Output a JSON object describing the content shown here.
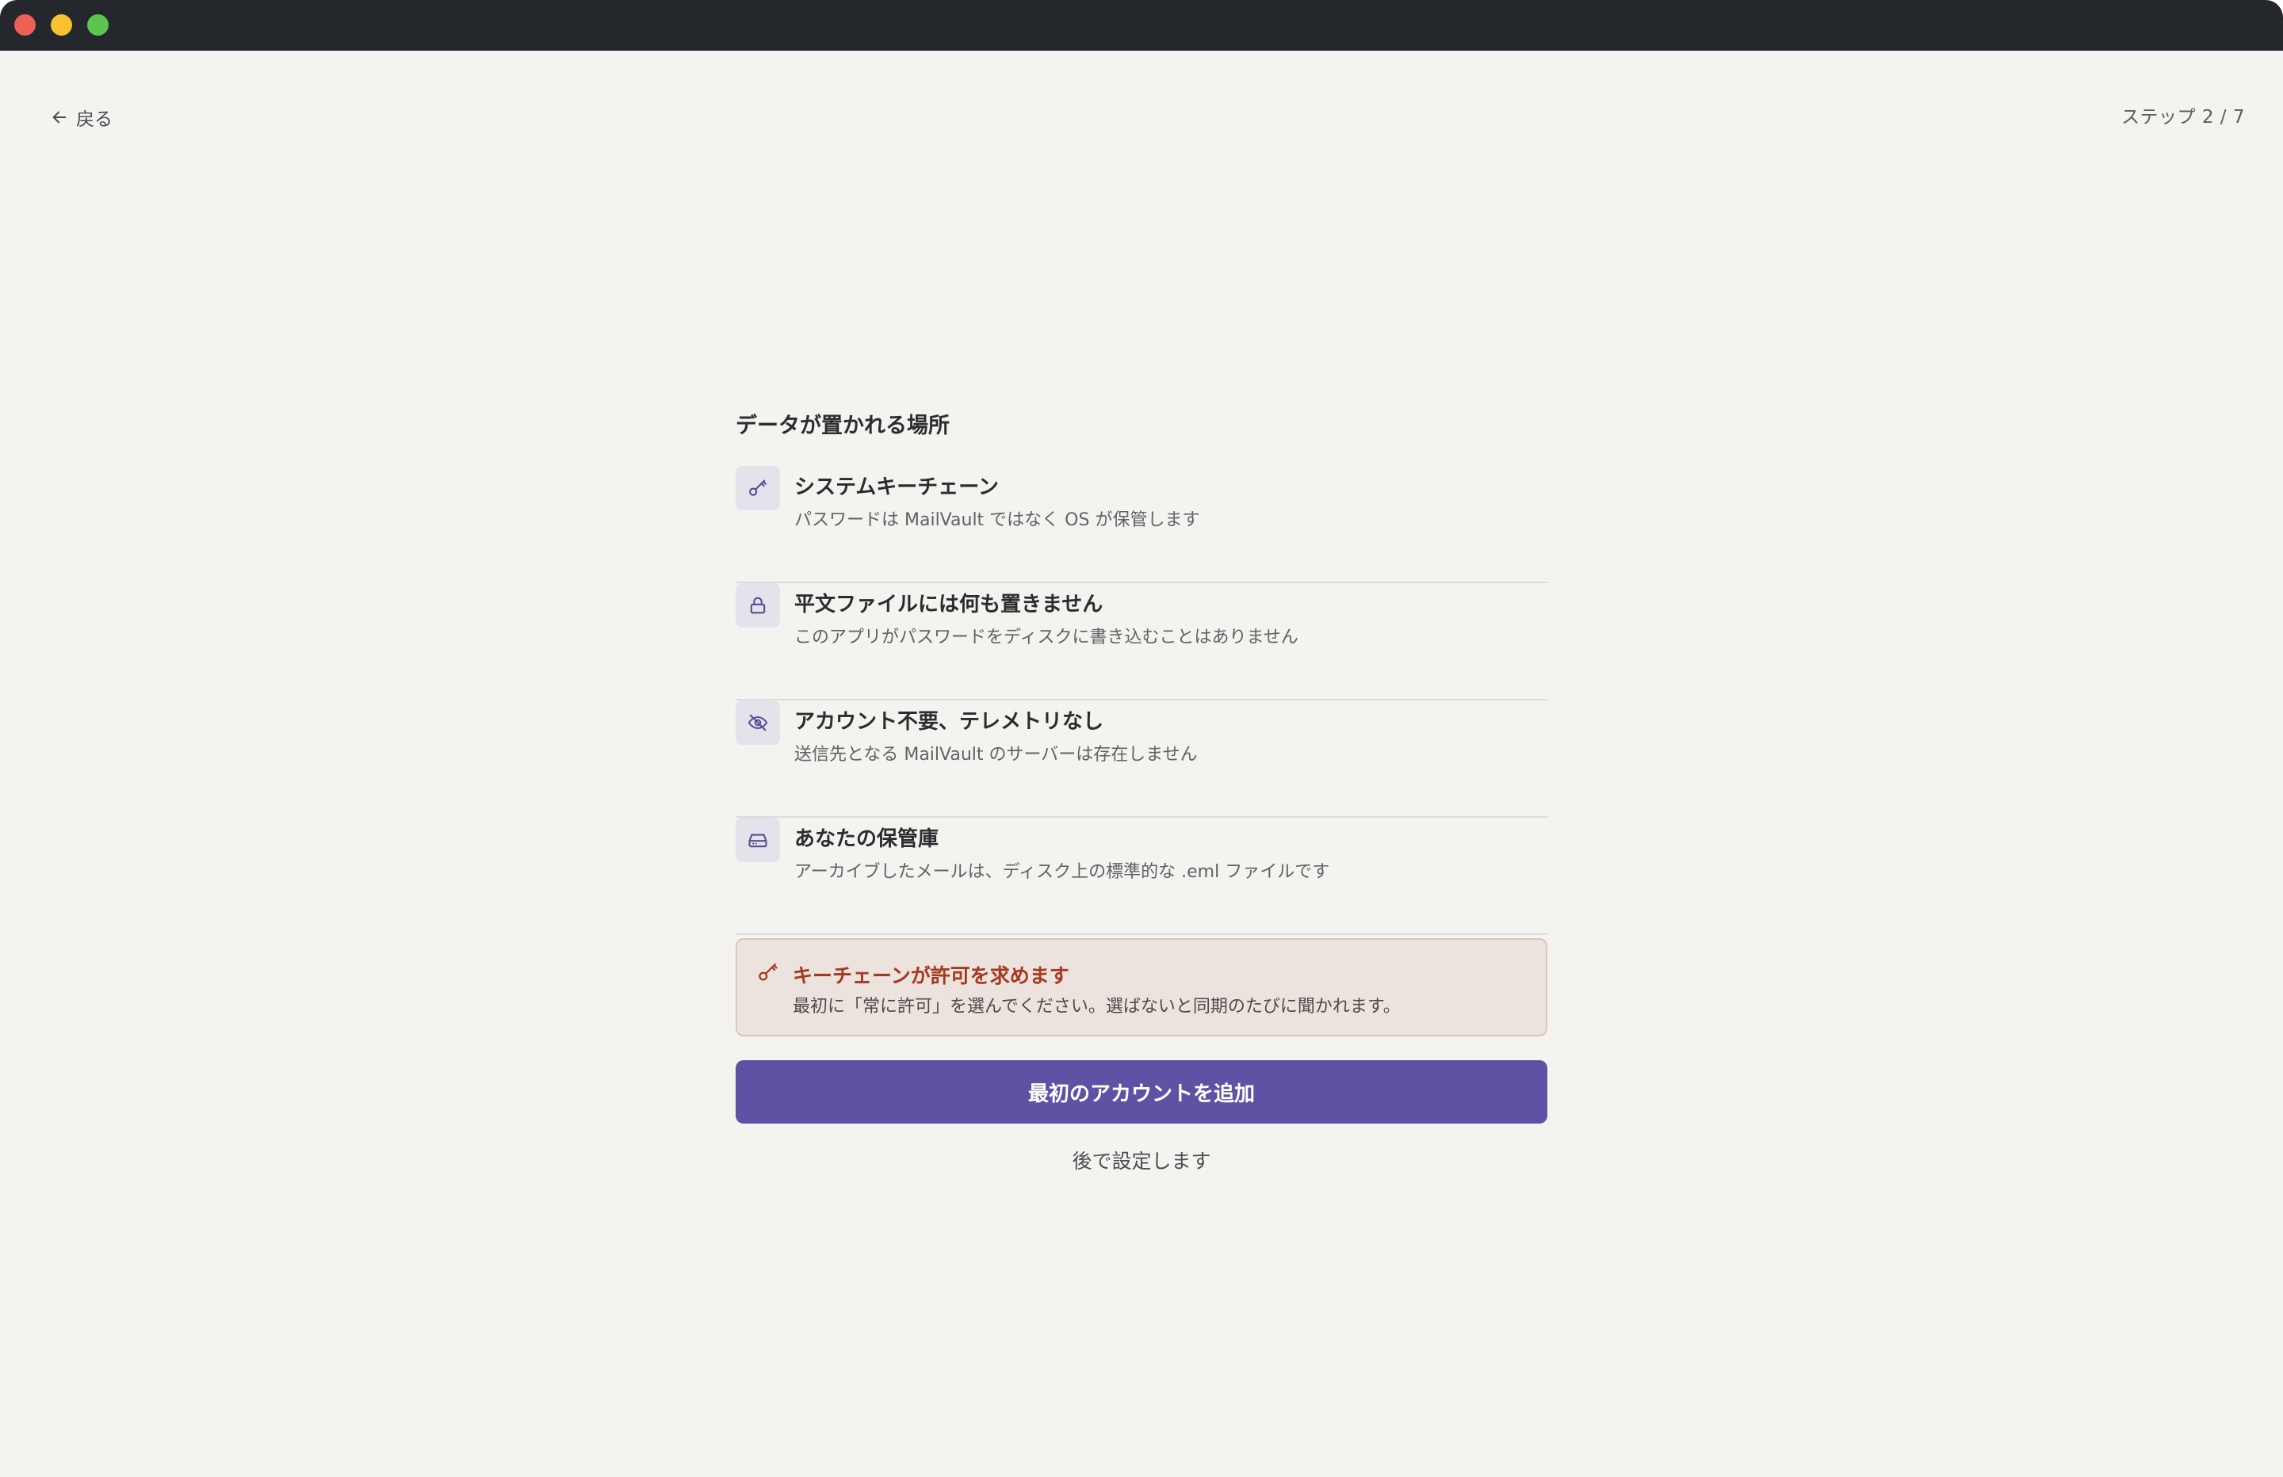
{
  "window": {
    "controls": [
      "close",
      "minimize",
      "maximize"
    ]
  },
  "nav": {
    "back_label": "戻る",
    "back_icon": "arrow-left-icon",
    "step_label": "ステップ 2 / 7"
  },
  "section": {
    "title": "データが置かれる場所"
  },
  "items": [
    {
      "icon": "key-icon",
      "title": "システムキーチェーン",
      "description": "パスワードは MailVault ではなく OS が保管します"
    },
    {
      "icon": "lock-icon",
      "title": "平文ファイルには何も置きません",
      "description": "このアプリがパスワードをディスクに書き込むことはありません"
    },
    {
      "icon": "eye-off-icon",
      "title": "アカウント不要、テレメトリなし",
      "description": "送信先となる MailVault のサーバーは存在しません"
    },
    {
      "icon": "hard-drive-icon",
      "title": "あなたの保管庫",
      "description": "アーカイブしたメールは、ディスク上の標準的な .eml ファイルです"
    }
  ],
  "notice": {
    "icon": "key-icon",
    "title": "キーチェーンが許可を求めます",
    "description": "最初に「常に許可」を選んでください。選ばないと同期のたびに聞かれます。"
  },
  "actions": {
    "primary_label": "最初のアカウントを追加",
    "secondary_label": "後で設定します"
  },
  "colors": {
    "background": "#f4f3f0",
    "titlebar": "#24272b",
    "accent": "#5e52a4",
    "icon_tile": "#e4e2eb",
    "icon_stroke": "#5a4d96",
    "notice_bg": "#ece2de",
    "notice_border": "#ddc5bd",
    "notice_text": "#a5391f"
  }
}
